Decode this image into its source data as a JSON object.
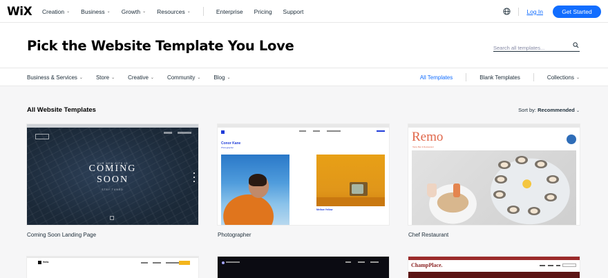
{
  "nav": {
    "logo": "WiX",
    "menu": [
      {
        "label": "Creation",
        "dropdown": true
      },
      {
        "label": "Business",
        "dropdown": true
      },
      {
        "label": "Growth",
        "dropdown": true
      },
      {
        "label": "Resources",
        "dropdown": true
      }
    ],
    "links": [
      "Enterprise",
      "Pricing",
      "Support"
    ],
    "login": "Log In",
    "cta": "Get Started",
    "icons": {
      "language": "globe-icon"
    }
  },
  "header": {
    "title": "Pick the Website Template You Love",
    "search_placeholder": "Search all templates...",
    "search_icon": "search-icon"
  },
  "categories": {
    "items": [
      "Business & Services",
      "Store",
      "Creative",
      "Community",
      "Blog"
    ],
    "right": {
      "all": "All Templates",
      "blank": "Blank Templates",
      "collections": "Collections"
    }
  },
  "main": {
    "section_title": "All Website Templates",
    "sort_label": "Sort by:",
    "sort_value": "Recommended"
  },
  "templates": [
    {
      "label": "Coming Soon Landing Page",
      "preview": {
        "small_top": "OUR NEW SITE IS",
        "big1": "COMING",
        "big2": "SOON",
        "small_bottom": "STAY TUNED"
      }
    },
    {
      "label": "Photographer",
      "preview": {
        "name": "Conor Kane",
        "role": "Photographer",
        "caption": "Mellow Yellow"
      }
    },
    {
      "label": "Chef Restaurant",
      "preview": {
        "name": "Remo",
        "sub": "Tasty Bar & Restaurant"
      }
    }
  ],
  "more_templates": [
    {
      "title": "Hello"
    },
    {},
    {
      "title": "ChampPlace."
    }
  ],
  "colors": {
    "accent": "#116dff",
    "text": "#20303c",
    "background": "#f6f6f7"
  }
}
